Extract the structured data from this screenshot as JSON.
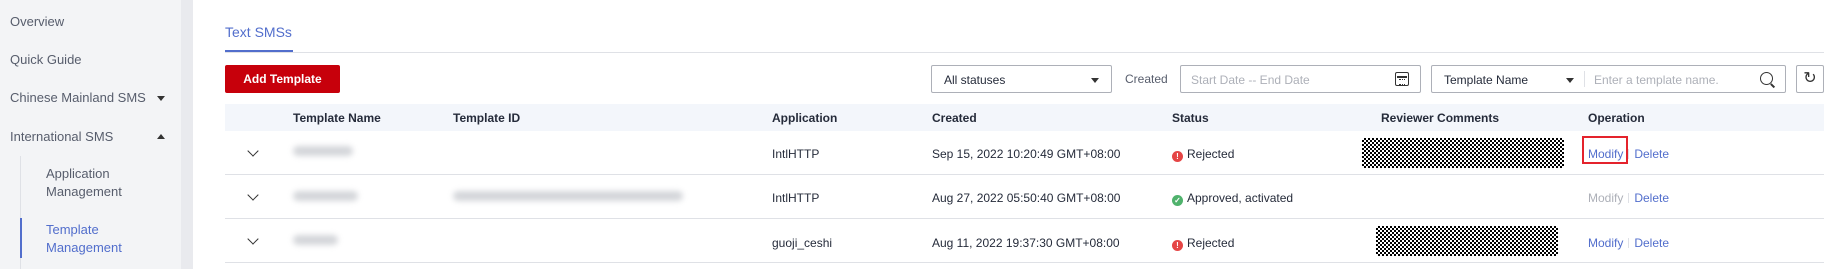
{
  "sidebar": {
    "items": [
      {
        "label": "Overview"
      },
      {
        "label": "Quick Guide"
      },
      {
        "label": "Chinese Mainland SMS"
      },
      {
        "label": "International SMS"
      }
    ],
    "sub_items": [
      {
        "label": "Application Management"
      },
      {
        "label": "Template Management"
      }
    ]
  },
  "tabs": [
    {
      "label": "Text SMSs"
    }
  ],
  "toolbar": {
    "add_label": "Add Template",
    "status_select": "All statuses",
    "created_label": "Created",
    "date_placeholder": "Start Date -- End Date",
    "field_select": "Template Name",
    "search_placeholder": "Enter a template name."
  },
  "table": {
    "headers": [
      "Template Name",
      "Template ID",
      "Application",
      "Created",
      "Status",
      "Reviewer Comments",
      "Operation"
    ],
    "rows": [
      {
        "application": "IntlHTTP",
        "created": "Sep 15, 2022 10:20:49 GMT+08:00",
        "status": "Rejected",
        "status_type": "rejected",
        "modify": "Modify",
        "delete": "Delete"
      },
      {
        "application": "IntlHTTP",
        "created": "Aug 27, 2022 05:50:40 GMT+08:00",
        "status": "Approved, activated",
        "status_type": "approved",
        "modify": "Modify",
        "delete": "Delete"
      },
      {
        "application": "guoji_ceshi",
        "created": "Aug 11, 2022 19:37:30 GMT+08:00",
        "status": "Rejected",
        "status_type": "rejected",
        "modify": "Modify",
        "delete": "Delete"
      }
    ]
  },
  "colors": {
    "accent": "#526ecc",
    "primary_button": "#c7000b",
    "rejected": "#e54545",
    "approved": "#4fb26c",
    "highlight": "#e4232c"
  }
}
